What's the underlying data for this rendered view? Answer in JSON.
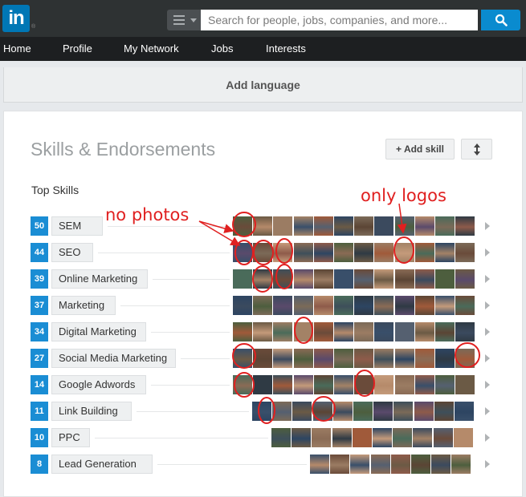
{
  "header": {
    "logo_text": "in",
    "search_placeholder": "Search for people, jobs, companies, and more..."
  },
  "nav": {
    "items": [
      "Home",
      "Profile",
      "My Network",
      "Jobs",
      "Interests"
    ]
  },
  "language_card": {
    "label": "Add language"
  },
  "skills": {
    "title": "Skills & Endorsements",
    "add_skill_label": "Add skill",
    "top_skills_label": "Top Skills",
    "list": [
      {
        "count": "50",
        "name": "SEM"
      },
      {
        "count": "44",
        "name": "SEO"
      },
      {
        "count": "39",
        "name": "Online Marketing"
      },
      {
        "count": "37",
        "name": "Marketing"
      },
      {
        "count": "34",
        "name": "Digital Marketing"
      },
      {
        "count": "27",
        "name": "Social Media Marketing"
      },
      {
        "count": "14",
        "name": "Google Adwords"
      },
      {
        "count": "11",
        "name": "Link Building"
      },
      {
        "count": "10",
        "name": "PPC"
      },
      {
        "count": "8",
        "name": "Lead Generation"
      }
    ]
  },
  "annotations": {
    "no_photos": "no photos",
    "only_logos": "only logos",
    "color": "#e02020"
  },
  "colors": {
    "brand": "#0077b5",
    "count_badge": "#1a8dd4",
    "topbar": "#2e3233",
    "navbar": "#1d1f21"
  }
}
